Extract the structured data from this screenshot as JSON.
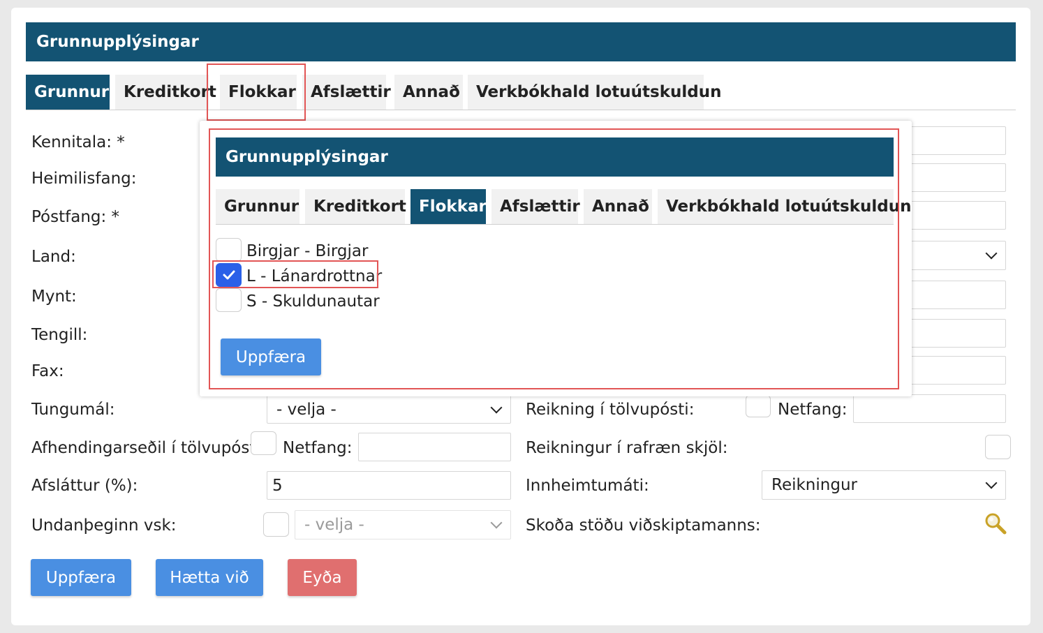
{
  "form": {
    "header_title": "Grunnupplýsingar",
    "tabs": [
      {
        "label": "Grunnur",
        "active": true
      },
      {
        "label": "Kreditkort",
        "active": false
      },
      {
        "label": "Flokkar",
        "active": false
      },
      {
        "label": "Afslættir",
        "active": false
      },
      {
        "label": "Annað",
        "active": false
      },
      {
        "label": "Verkbókhald lotuútskuldun",
        "active": false
      }
    ],
    "labels": {
      "kennitala": "Kennitala: *",
      "heimilisfang": "Heimilisfang:",
      "postfang": "Póstfang: *",
      "land": "Land:",
      "mynt": "Mynt:",
      "tengill": "Tengill:",
      "fax": "Fax:",
      "tungumal": "Tungumál:",
      "afhending": "Afhendingarseðil í tölvupósti:",
      "afhending_netfang": "Netfang:",
      "afslattur": "Afsláttur (%):",
      "undanthegin": "Undanþeginn vsk:",
      "reikning_tolvuposti": "Reikning í tölvupósti:",
      "reikning_netfang": "Netfang:",
      "rafraen": "Reikningur í rafræn skjöl:",
      "innheimtumati": "Innheimtumáti:",
      "skoda_stodu": "Skoða stöðu viðskiptamanns:"
    },
    "values": {
      "tungumal": "- velja -",
      "afslattur": "5",
      "undanthegin_select": "- velja -",
      "innheimtumati": "Reikningur"
    },
    "buttons": {
      "update": "Uppfæra",
      "cancel": "Hætta við",
      "delete": "Eyða"
    }
  },
  "popup": {
    "header_title": "Grunnupplýsingar",
    "tabs": [
      {
        "label": "Grunnur",
        "active": false
      },
      {
        "label": "Kreditkort",
        "active": false
      },
      {
        "label": "Flokkar",
        "active": true
      },
      {
        "label": "Afslættir",
        "active": false
      },
      {
        "label": "Annað",
        "active": false
      },
      {
        "label": "Verkbókhald lotuútskuldun",
        "active": false
      }
    ],
    "categories": [
      {
        "label": "Birgjar - Birgjar",
        "checked": false
      },
      {
        "label": "L - Lánardrottnar",
        "checked": true
      },
      {
        "label": "S - Skuldunautar",
        "checked": false
      }
    ],
    "update_button": "Uppfæra"
  },
  "colors": {
    "header_bg": "#135373",
    "primary_button": "#4a8fe2",
    "danger_button": "#e06f6f",
    "highlight_border": "#e25555",
    "checkbox_checked": "#2a60e8"
  },
  "icons": [
    "chevron-down-icon",
    "magnifier-icon",
    "checkmark-icon"
  ]
}
